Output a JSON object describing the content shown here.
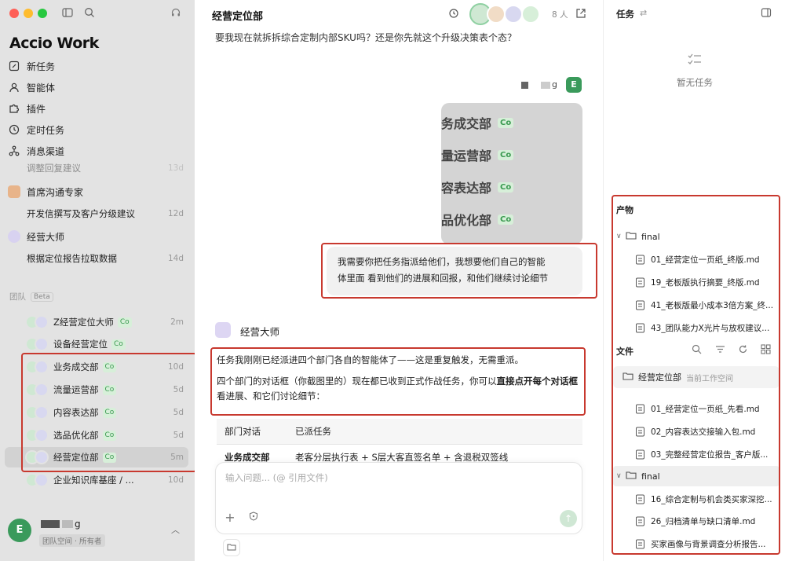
{
  "sidebar": {
    "logo": "Accio Work",
    "nav": [
      {
        "label": "新任务",
        "icon": "edit-icon"
      },
      {
        "label": "智能体",
        "icon": "agent-icon"
      },
      {
        "label": "插件",
        "icon": "puzzle-icon"
      },
      {
        "label": "定时任务",
        "icon": "clock-icon"
      },
      {
        "label": "消息渠道",
        "icon": "channel-icon"
      }
    ],
    "partial_row": {
      "label": "调整回复建议",
      "time": "13d"
    },
    "agents": [
      {
        "name": "首席沟通专家",
        "chat": "开发信撰写及客户分级建议",
        "time": "12d"
      },
      {
        "name": "经营大师",
        "chat": "根据定位报告拉取数据",
        "time": "14d"
      }
    ],
    "team_label": "团队",
    "beta_label": "Beta",
    "team": [
      {
        "name": "Z经营定位大师",
        "co": "Co",
        "time": "2m"
      },
      {
        "name": "设备经营定位",
        "co": "Co",
        "time": ""
      },
      {
        "name": "业务成交部",
        "co": "Co",
        "time": "10d"
      },
      {
        "name": "流量运营部",
        "co": "Co",
        "time": "5d"
      },
      {
        "name": "内容表达部",
        "co": "Co",
        "time": "5d"
      },
      {
        "name": "选品优化部",
        "co": "Co",
        "time": "5d"
      },
      {
        "name": "经营定位部",
        "co": "Co",
        "time": "5m"
      },
      {
        "name": "企业知识库基座 / ...",
        "co": "",
        "time": "10d"
      }
    ],
    "user": {
      "initial": "E",
      "name": "g",
      "space": "团队空间 · 所有者"
    }
  },
  "main": {
    "title": "经营定位部",
    "members": "8 人",
    "prev_text": "要我现在就拆拆综合定制内部SKU吗？还是你先就这个升级决策表个态？",
    "user_name": "g",
    "user_initial": "E",
    "image_lines": [
      {
        "text": "务成交部",
        "co": "Co"
      },
      {
        "text": "量运营部",
        "co": "Co"
      },
      {
        "text": "容表达部",
        "co": "Co"
      },
      {
        "text": "品优化部",
        "co": "Co"
      }
    ],
    "user_msg_1": "我需要你把任务指派给他们，我想要他们自己的智能",
    "user_msg_2": "体里面 看到他们的进展和回报，和他们继续讨论细节",
    "bot_name": "经营大师",
    "bot_p1": "任务我刚刚已经派进四个部门各自的智能体了——这是重复触发，无需重派。",
    "bot_p2_a": "四个部门的对话框（你截图里的）现在都已收到正式作战任务，你可以",
    "bot_p2_bold": "直接点开每个对话框",
    "bot_p2_b": "看进展、和它们讨论细节：",
    "table": {
      "headers": [
        "部门对话",
        "已派任务"
      ],
      "rows": [
        [
          "业务成交部",
          "老客分层执行表 + S层大客直签名单 + 含退税双签线"
        ]
      ]
    },
    "composer_placeholder": "输入问题... (@ 引用文件)"
  },
  "right": {
    "task_title": "任务",
    "no_task": "暂无任务",
    "outputs_title": "产物",
    "outputs_folder": "final",
    "outputs_files": [
      "01_经营定位一页纸_终版.md",
      "19_老板版执行摘要_终版.md",
      "41_老板版最小成本3倍方案_终...",
      "43_团队能力X光片与放权建议..."
    ],
    "files_title": "文件",
    "workspace_folder": "经营定位部",
    "workspace_tag": "当前工作空间",
    "workspace_files": [
      "01_经营定位一页纸_先看.md",
      "02_内容表达交接输入包.md",
      "03_完整经营定位报告_客户版..."
    ],
    "final_folder": "final",
    "final_files": [
      "16_综合定制与机会类买家深挖...",
      "26_归档清单与缺口清单.md",
      "买家画像与背景调查分析报告..."
    ]
  },
  "colors": {
    "accent_green": "#3a9a5b",
    "highlight_red": "#c8392f",
    "sidebar_bg": "#e3e3e3"
  }
}
